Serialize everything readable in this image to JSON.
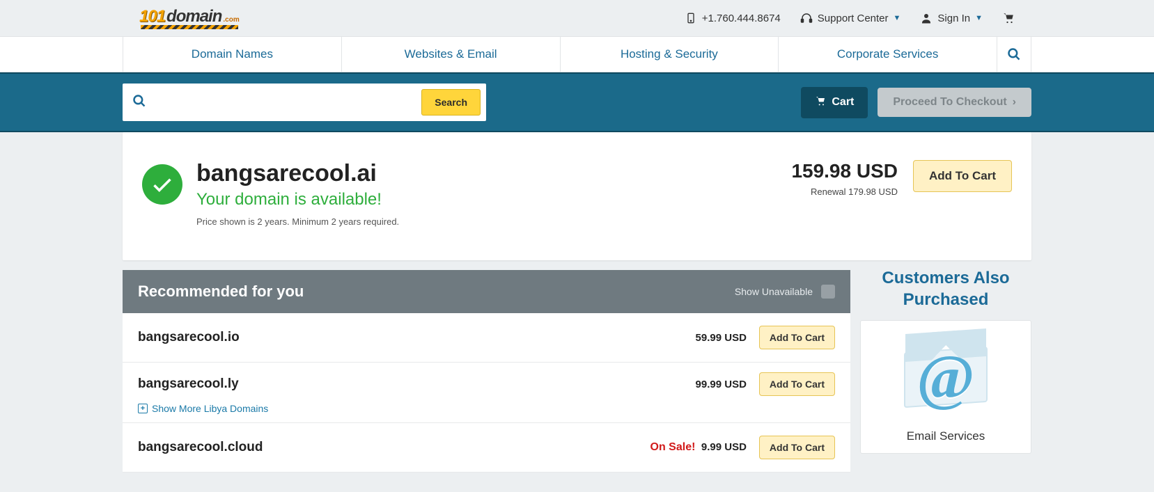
{
  "topbar": {
    "phone": "+1.760.444.8674",
    "support": "Support Center",
    "signin": "Sign In"
  },
  "nav": {
    "items": [
      "Domain Names",
      "Websites & Email",
      "Hosting & Security",
      "Corporate Services"
    ]
  },
  "search": {
    "button": "Search",
    "cart": "Cart",
    "checkout": "Proceed To Checkout"
  },
  "availability": {
    "domain": "bangsarecool.ai",
    "status": "Your domain is available!",
    "fineprint": "Price shown is 2 years. Minimum 2 years required.",
    "price": "159.98 USD",
    "renewal": "Renewal 179.98 USD",
    "add": "Add To Cart"
  },
  "recommended": {
    "heading": "Recommended for you",
    "show_unavailable": "Show Unavailable",
    "add": "Add To Cart",
    "on_sale": "On Sale!",
    "items": [
      {
        "domain": "bangsarecool.io",
        "price": "59.99 USD",
        "sale": false,
        "show_more": null
      },
      {
        "domain": "bangsarecool.ly",
        "price": "99.99 USD",
        "sale": false,
        "show_more": "Show More Libya Domains"
      },
      {
        "domain": "bangsarecool.cloud",
        "price": "9.99 USD",
        "sale": true,
        "show_more": null
      }
    ]
  },
  "sidebar": {
    "title_line1": "Customers Also",
    "title_line2": "Purchased",
    "card_label": "Email Services"
  }
}
